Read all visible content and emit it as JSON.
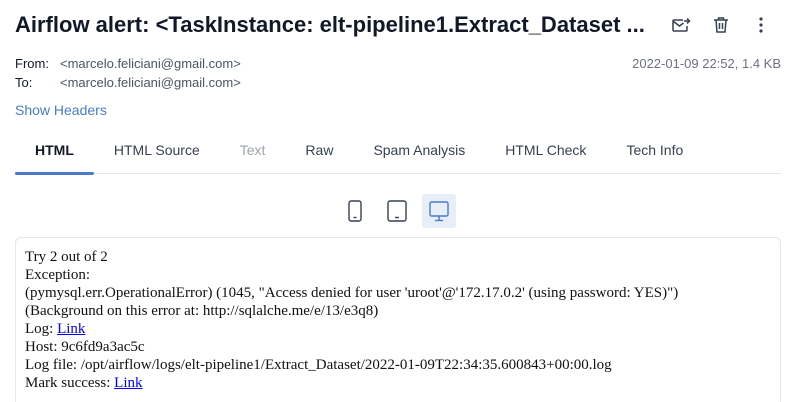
{
  "email": {
    "subject": "Airflow alert: <TaskInstance: elt-pipeline1.Extract_Dataset ...",
    "from_label": "From:",
    "from_value": "<marcelo.feliciani@gmail.com>",
    "to_label": "To:",
    "to_value": "<marcelo.feliciani@gmail.com>",
    "date_size": "2022-01-09 22:52, 1.4 KB",
    "show_headers": "Show Headers"
  },
  "actions": [
    {
      "icon": "forward-mail-icon"
    },
    {
      "icon": "trash-icon"
    },
    {
      "icon": "more-vertical-icon"
    }
  ],
  "tabs": [
    {
      "label": "HTML",
      "state": "active"
    },
    {
      "label": "HTML Source",
      "state": "normal"
    },
    {
      "label": "Text",
      "state": "disabled"
    },
    {
      "label": "Raw",
      "state": "normal"
    },
    {
      "label": "Spam Analysis",
      "state": "normal"
    },
    {
      "label": "HTML Check",
      "state": "normal"
    },
    {
      "label": "Tech Info",
      "state": "normal"
    }
  ],
  "devices": [
    {
      "icon": "mobile-icon",
      "active": false
    },
    {
      "icon": "tablet-icon",
      "active": false
    },
    {
      "icon": "desktop-icon",
      "active": true
    }
  ],
  "body": {
    "line1": "Try 2 out of 2",
    "line2": "Exception:",
    "line3": "(pymysql.err.OperationalError) (1045, \"Access denied for user 'uroot'@'172.17.0.2' (using password: YES)\")",
    "line4": "(Background on this error at: http://sqlalche.me/e/13/e3q8)",
    "log_label": "Log: ",
    "log_link": "Link",
    "host": "Host: 9c6fd9a3ac5c",
    "log_file": "Log file: /opt/airflow/logs/elt-pipeline1/Extract_Dataset/2022-01-09T22:34:35.600843+00:00.log",
    "mark_label": "Mark success: ",
    "mark_link": "Link"
  },
  "colors": {
    "accent": "#4a7cc8",
    "link": "#0000ee",
    "active_device_bg": "#e8eef8"
  }
}
